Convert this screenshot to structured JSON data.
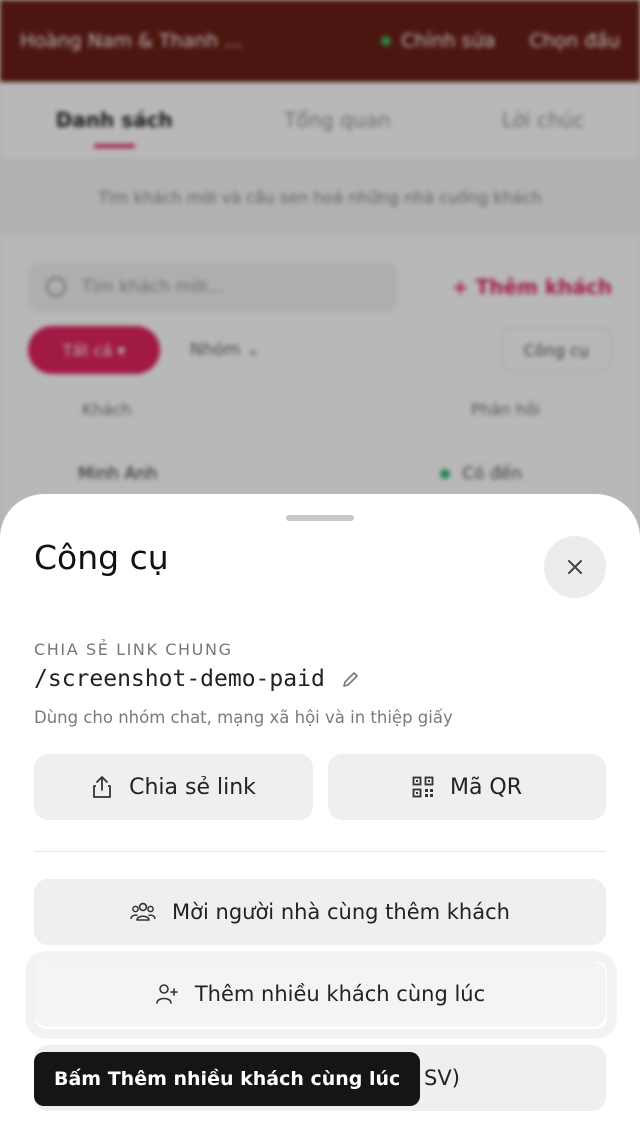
{
  "background": {
    "topbar": {
      "couple_name": "Hoàng Nam & Thanh ...",
      "edit_label": "Chỉnh sửa",
      "save_label": "Chọn đầu"
    },
    "tabs": [
      {
        "label": "Danh sách",
        "active": true
      },
      {
        "label": "Tổng quan",
        "active": false
      },
      {
        "label": "Lời chúc",
        "active": false
      }
    ],
    "hint_text": "Tìm khách mời và cầu sen hoá những nhà cuống khách",
    "search_placeholder": "Tìm khách mời...",
    "add_guest_label": "+ Thêm khách",
    "filter_all_label": "Tất cả ▾",
    "filter_group_label": "Nhóm ⌄",
    "tools_label": "Công cụ",
    "table_headers": [
      "Khách",
      "Phản hồi"
    ],
    "rows": [
      {
        "name": "Minh Anh",
        "status": "Có đến"
      }
    ]
  },
  "sheet": {
    "title": "Công cụ",
    "share_section_label": "CHIA SẺ LINK CHUNG",
    "link_path": "/screenshot-demo-paid",
    "link_description": "Dùng cho nhóm chat, mạng xã hội và in thiệp giấy",
    "share_button_label": "Chia sẻ link",
    "qr_button_label": "Mã QR",
    "invite_family_label": "Mời người nhà cùng thêm khách",
    "bulk_add_label": "Thêm nhiều khách cùng lúc",
    "csv_partial_label": "SV)"
  },
  "tooltip": {
    "text": "Bấm Thêm nhiều khách cùng lúc"
  },
  "colors": {
    "accent": "#e0245e",
    "topbar": "#6b1e16",
    "tooltip_bg": "#151515"
  }
}
